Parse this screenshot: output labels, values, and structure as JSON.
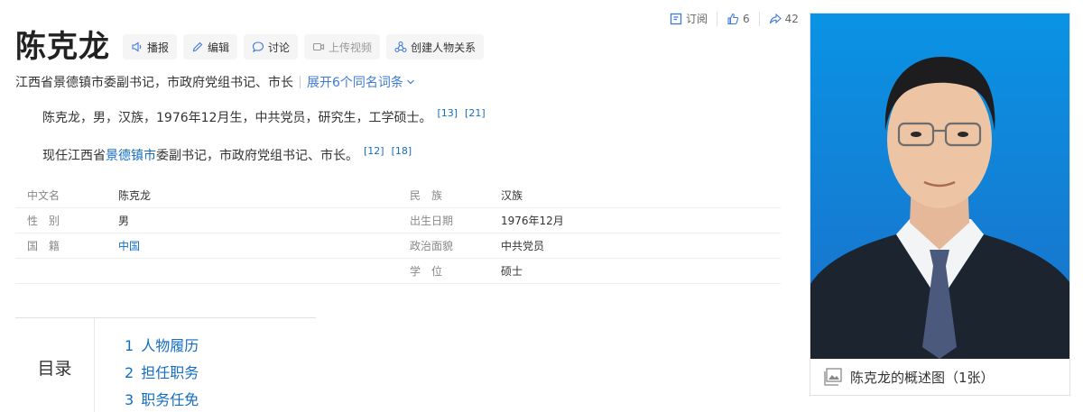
{
  "actions": {
    "subscribe": "订阅",
    "like_count": "6",
    "share_count": "42"
  },
  "title": "陈克龙",
  "toolbar": {
    "broadcast": "播报",
    "edit": "编辑",
    "discuss": "讨论",
    "upload_video": "上传视频",
    "create_relation": "创建人物关系"
  },
  "subtitle": {
    "text": "江西省景德镇市委副书记，市政府党组书记、市长",
    "expand": "展开6个同名词条"
  },
  "summary": {
    "p1_text": "陈克龙，男，汉族，1976年12月生，中共党员，研究生，工学硕士。",
    "p1_refs": [
      "[13]",
      "[21]"
    ],
    "p2_before": "现任江西省",
    "p2_link": "景德镇市",
    "p2_after": "委副书记，市政府党组书记、市长。",
    "p2_refs": [
      "[12]",
      "[18]"
    ]
  },
  "info": {
    "rows": [
      {
        "k1": "中文名",
        "v1": "陈克龙",
        "k2": "民　族",
        "v2": "汉族"
      },
      {
        "k1": "性　别",
        "v1": "男",
        "k2": "出生日期",
        "v2": "1976年12月"
      },
      {
        "k1": "国　籍",
        "v1": "中国",
        "k2": "政治面貌",
        "v2": "中共党员"
      },
      {
        "k1": "",
        "v1": "",
        "k2": "学　位",
        "v2": "硕士"
      }
    ]
  },
  "toc": {
    "label": "目录",
    "items": [
      {
        "num": "1",
        "text": "人物履历"
      },
      {
        "num": "2",
        "text": "担任职务"
      },
      {
        "num": "3",
        "text": "职务任免"
      }
    ]
  },
  "photo": {
    "caption": "陈克龙的概述图（1张）"
  },
  "colors": {
    "link": "#136ec2",
    "photo_bg": "#0a8fe0"
  }
}
